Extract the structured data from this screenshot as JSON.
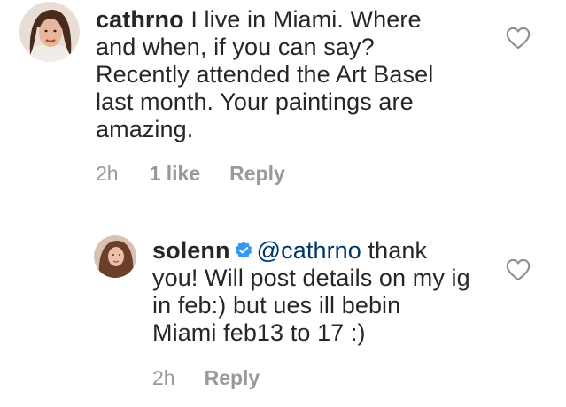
{
  "comments": [
    {
      "username": "cathrno",
      "text": "I live in Miami. Where and when, if you can say? Recently attended the Art Basel last month. Your paintings are amazing.",
      "time": "2h",
      "likes": "1 like",
      "reply_label": "Reply",
      "liked": false
    },
    {
      "username": "solenn",
      "verified": true,
      "mention": "@cathrno",
      "text": "thank you! Will post details on my ig in feb:) but ues ill bebin Miami feb13 to 17 :)",
      "time": "2h",
      "reply_label": "Reply",
      "liked": false
    }
  ],
  "icons": {
    "like": "heart-outline-icon",
    "verified": "verified-badge-icon"
  },
  "colors": {
    "text": "#262626",
    "secondary": "#999999",
    "mention": "#003569",
    "verified": "#3897f0"
  }
}
